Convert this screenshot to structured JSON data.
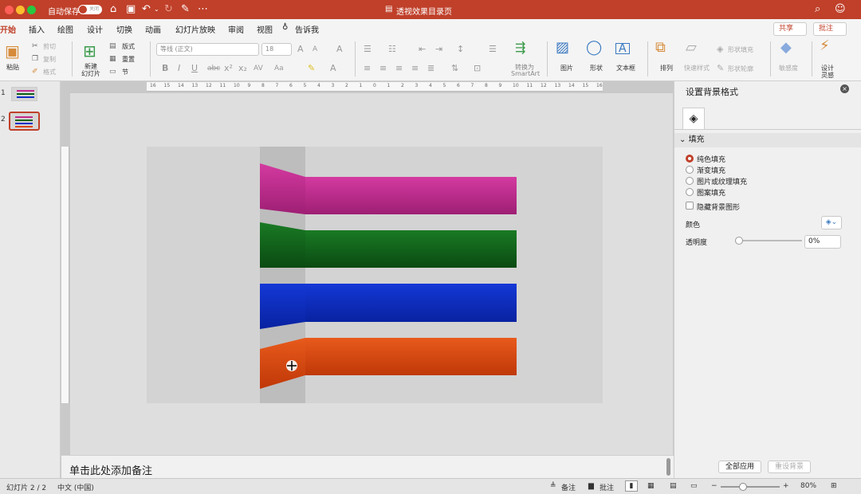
{
  "titlebar": {
    "autosave": "自动保存",
    "toggle": "关闭",
    "doc_title": "透视效果目录页",
    "colors": {
      "close": "#fe5f57",
      "minimize": "#febc2e",
      "maximize": "#28c840"
    }
  },
  "menus": [
    "开始",
    "插入",
    "绘图",
    "设计",
    "切换",
    "动画",
    "幻灯片放映",
    "审阅",
    "视图"
  ],
  "tell_me": "告诉我",
  "share": "共享",
  "comments_btn": "批注",
  "ribbon": {
    "paste": "粘贴",
    "cut": "剪切",
    "copy": "复制",
    "format": "格式",
    "new_slide": "新建",
    "new_slide2": "幻灯片",
    "layout": "版式",
    "reset": "重置",
    "section": "节",
    "font_name": "等线 (正文)",
    "font_size": "18",
    "convert": "转换为",
    "smartart": "SmartArt",
    "picture": "图片",
    "shapes": "形状",
    "textbox": "文本框",
    "arrange": "排列",
    "quick_styles": "快速样式",
    "shape_fill": "形状填充",
    "shape_outline": "形状轮廓",
    "sensitivity": "敏感度",
    "designer": "设计",
    "designer2": "灵感"
  },
  "ruler_labels": [
    "16",
    "15",
    "14",
    "13",
    "12",
    "11",
    "10",
    "9",
    "8",
    "7",
    "6",
    "5",
    "4",
    "3",
    "2",
    "1",
    "0",
    "1",
    "2",
    "3",
    "4",
    "5",
    "6",
    "7",
    "8",
    "9",
    "10",
    "11",
    "12",
    "13",
    "14",
    "15",
    "16"
  ],
  "thumbs": [
    {
      "num": "1"
    },
    {
      "num": "2"
    }
  ],
  "slide": {
    "bars": [
      {
        "name": "pink",
        "color": "#c42a8e"
      },
      {
        "name": "green",
        "color": "#0f6418"
      },
      {
        "name": "blue",
        "color": "#0a2ec4"
      },
      {
        "name": "orange",
        "color": "#dd4510"
      }
    ]
  },
  "notes_placeholder": "单击此处添加备注",
  "pane": {
    "title": "设置背景格式",
    "section": "填充",
    "options": [
      "纯色填充",
      "渐变填充",
      "图片或纹理填充",
      "图案填充"
    ],
    "hide_bg": "隐藏背景图形",
    "color_label": "颜色",
    "transparency_label": "透明度",
    "transparency": "0%",
    "apply_all": "全部应用",
    "reset_bg": "重设背景"
  },
  "status": {
    "slide": "幻灯片 2 / 2",
    "lang": "中文 (中国)",
    "notes": "备注",
    "comments": "批注",
    "zoom": "80%"
  }
}
